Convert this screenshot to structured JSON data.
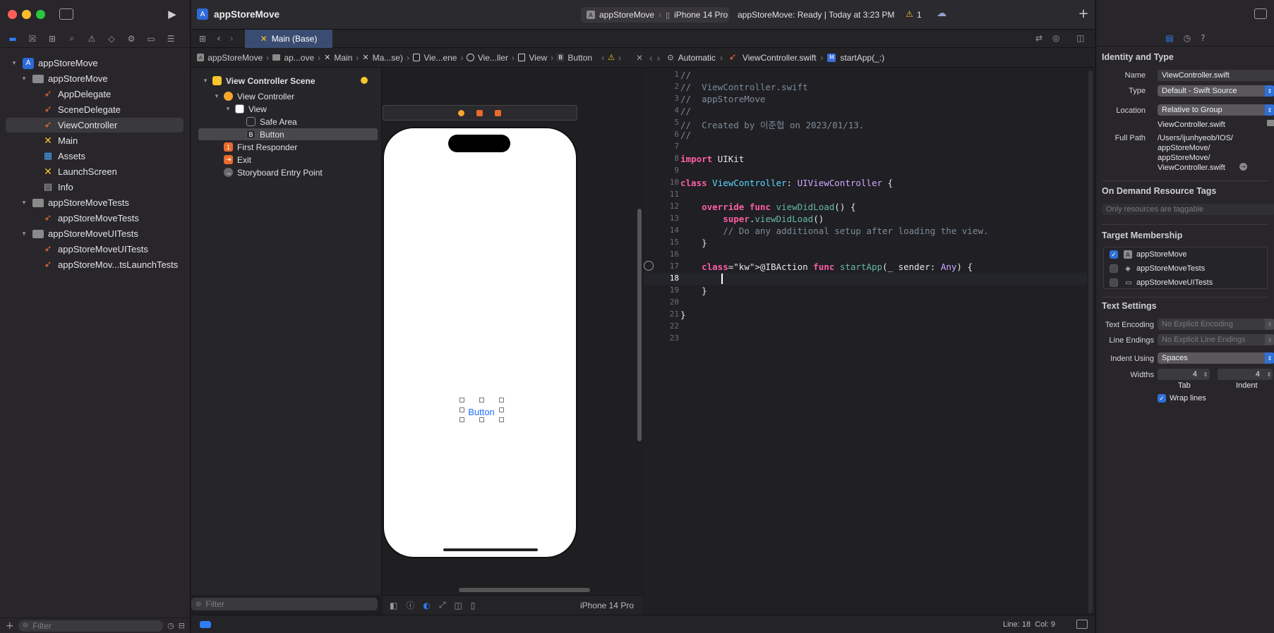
{
  "window": {
    "project_title": "appStoreMove",
    "status": "appStoreMove: Ready | Today at 3:23 PM",
    "warning_count": "1"
  },
  "scheme": {
    "target": "appStoreMove",
    "device": "iPhone 14 Pro"
  },
  "tab": {
    "label": "Main (Base)"
  },
  "navigator": {
    "filter_placeholder": "Filter",
    "items": [
      {
        "label": "appStoreMove",
        "kind": "project",
        "indent": 0,
        "disclosure": "▾"
      },
      {
        "label": "appStoreMove",
        "kind": "folder",
        "indent": 1,
        "disclosure": "▾"
      },
      {
        "label": "AppDelegate",
        "kind": "swift",
        "indent": 2
      },
      {
        "label": "SceneDelegate",
        "kind": "swift",
        "indent": 2
      },
      {
        "label": "ViewController",
        "kind": "swift",
        "indent": 2,
        "selected": true
      },
      {
        "label": "Main",
        "kind": "storyboard",
        "indent": 2
      },
      {
        "label": "Assets",
        "kind": "assets",
        "indent": 2
      },
      {
        "label": "LaunchScreen",
        "kind": "storyboard",
        "indent": 2
      },
      {
        "label": "Info",
        "kind": "info",
        "indent": 2
      },
      {
        "label": "appStoreMoveTests",
        "kind": "folder",
        "indent": 1,
        "disclosure": "▾"
      },
      {
        "label": "appStoreMoveTests",
        "kind": "swift",
        "indent": 2
      },
      {
        "label": "appStoreMoveUITests",
        "kind": "folder",
        "indent": 1,
        "disclosure": "▾"
      },
      {
        "label": "appStoreMoveUITests",
        "kind": "swift",
        "indent": 2
      },
      {
        "label": "appStoreMov...tsLaunchTests",
        "kind": "swift",
        "indent": 2
      }
    ]
  },
  "jumpbar_canvas": [
    "appStoreMove",
    "ap...ove",
    "Main",
    "Ma...se)",
    "Vie...ene",
    "Vie...ller",
    "View",
    "Button"
  ],
  "jumpbar_editor": [
    "Automatic",
    "ViewController.swift",
    "startApp(_:)"
  ],
  "outline": {
    "filter_placeholder": "Filter",
    "items": [
      {
        "label": "View Controller Scene",
        "bold": true
      },
      {
        "label": "View Controller"
      },
      {
        "label": "View"
      },
      {
        "label": "Safe Area"
      },
      {
        "label": "Button",
        "selected": true
      },
      {
        "label": "First Responder"
      },
      {
        "label": "Exit"
      },
      {
        "label": "Storyboard Entry Point"
      }
    ]
  },
  "canvas": {
    "button_label": "Button",
    "device_label": "iPhone 14 Pro"
  },
  "code": {
    "lines": [
      "//",
      "//  ViewController.swift",
      "//  appStoreMove",
      "//",
      "//  Created by 이준협 on 2023/01/13.",
      "//",
      "",
      "import UIKit",
      "",
      "class ViewController: UIViewController {",
      "",
      "    override func viewDidLoad() {",
      "        super.viewDidLoad()",
      "        // Do any additional setup after loading the view.",
      "    }",
      "",
      "    @IBAction func startApp(_ sender: Any) {",
      "        ",
      "    }",
      "",
      "}",
      "",
      ""
    ],
    "current_line": 18,
    "cursor_position": "Line: 18  Col: 9"
  },
  "inspector": {
    "identity_title": "Identity and Type",
    "name_label": "Name",
    "name_value": "ViewController.swift",
    "type_label": "Type",
    "type_value": "Default - Swift Source",
    "location_label": "Location",
    "location_value": "Relative to Group",
    "location_file": "ViewController.swift",
    "fullpath_label": "Full Path",
    "fullpath_lines": [
      "/Users/ijunhyeob/IOS/",
      "appStoreMove/",
      "appStoreMove/",
      "ViewController.swift"
    ],
    "odr_title": "On Demand Resource Tags",
    "odr_placeholder": "Only resources are taggable",
    "target_title": "Target Membership",
    "targets": [
      {
        "label": "appStoreMove",
        "checked": true
      },
      {
        "label": "appStoreMoveTests",
        "checked": false
      },
      {
        "label": "appStoreMoveUITests",
        "checked": false
      }
    ],
    "text_title": "Text Settings",
    "encoding_label": "Text Encoding",
    "encoding_value": "No Explicit Encoding",
    "endings_label": "Line Endings",
    "endings_value": "No Explicit Line Endings",
    "indent_label": "Indent Using",
    "indent_value": "Spaces",
    "widths_label": "Widths",
    "tab_width": "4",
    "indent_width": "4",
    "tab_caption": "Tab",
    "indent_caption": "Indent",
    "wrap_label": "Wrap lines",
    "wrap_checked": true
  },
  "colors": {
    "accent": "#2f7cf6",
    "selection": "#3a4c72",
    "swift_orange": "#f46f36",
    "storyboard_yellow": "#f7c52e",
    "warning": "#f7c52e"
  }
}
